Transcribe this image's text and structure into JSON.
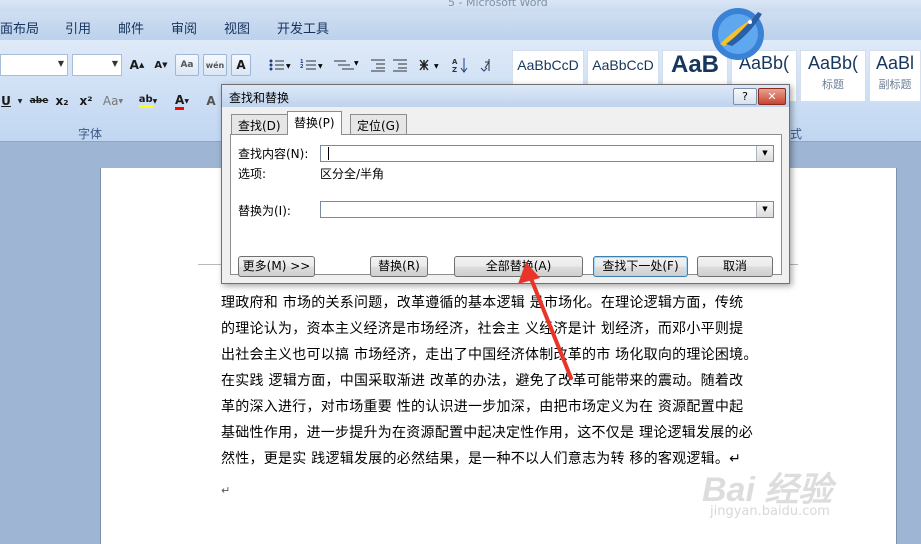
{
  "window": {
    "title": "5 - Microsoft Word"
  },
  "ribbon_tabs": [
    "面布局",
    "引用",
    "邮件",
    "审阅",
    "视图",
    "开发工具"
  ],
  "font_group": {
    "label": "字体",
    "grow_font": "A",
    "shrink_font": "A",
    "clear_format": "Aa",
    "pinyin_guide": "wén",
    "char_border": "A",
    "underline": "U",
    "strikethrough": "abe",
    "subscript": "x₂",
    "superscript": "x²",
    "change_case": "Aa",
    "highlight": "ab",
    "font_color": "A",
    "char_shading": "A"
  },
  "styles_group": {
    "label": "式",
    "items": [
      {
        "sample": "AaBbCcD",
        "name": ""
      },
      {
        "sample": "AaBbCcD",
        "name": ""
      },
      {
        "sample": "AaB",
        "name": ""
      },
      {
        "sample": "AaBb(",
        "name": ""
      },
      {
        "sample": "AaBb(",
        "name": "标题"
      },
      {
        "sample": "AaBl",
        "name": "副标题"
      }
    ]
  },
  "colors": {
    "highlight": "#ffff00",
    "font_color": "#ff0000",
    "arrow": "#e8352a"
  },
  "dialog": {
    "title": "查找和替换",
    "help": "?",
    "close": "✕",
    "tabs": [
      "查找(D)",
      "替换(P)",
      "定位(G)"
    ],
    "active_tab": "替换(P)",
    "find_label": "查找内容(N):",
    "find_value": "",
    "options_label": "选项:",
    "options_value": "区分全/半角",
    "replace_label": "替换为(I):",
    "replace_value": "",
    "more_button": "更多(M) >>",
    "replace_button": "替换(R)",
    "replace_all_button": "全部替换(A)",
    "find_next_button": "查找下一处(F)",
    "cancel_button": "取消"
  },
  "document": {
    "lines": [
      "理政府和 市场的关系问题，改革遵循的基本逻辑 是市场化。在理论逻辑方面，传统",
      "的理论认为，资本主义经济是市场经济，社会主 义经济是计 划经济，而邓小平则提",
      "出社会主义也可以搞  市场经济，走出了中国经济体制改革的市  场化取向的理论困境。",
      "在实践 逻辑方面，中国采取渐进 改革的办法，避免了改革可能带来的震动。随着改",
      "革的深入进行，对市场重要 性的认识进一步加深，由把市场定义为在 资源配置中起",
      "基础性作用，进一步提升为在资源配置中起决定性作用，这不仅是 理论逻辑发展的必",
      "然性，更是实 践逻辑发展的必然结果，是一种不以人们意志为转 移的客观逻辑。↵"
    ],
    "paragraph_mark": "↵"
  },
  "watermark": {
    "brand": "Bai 经验",
    "url": "jingyan.baidu.com"
  }
}
